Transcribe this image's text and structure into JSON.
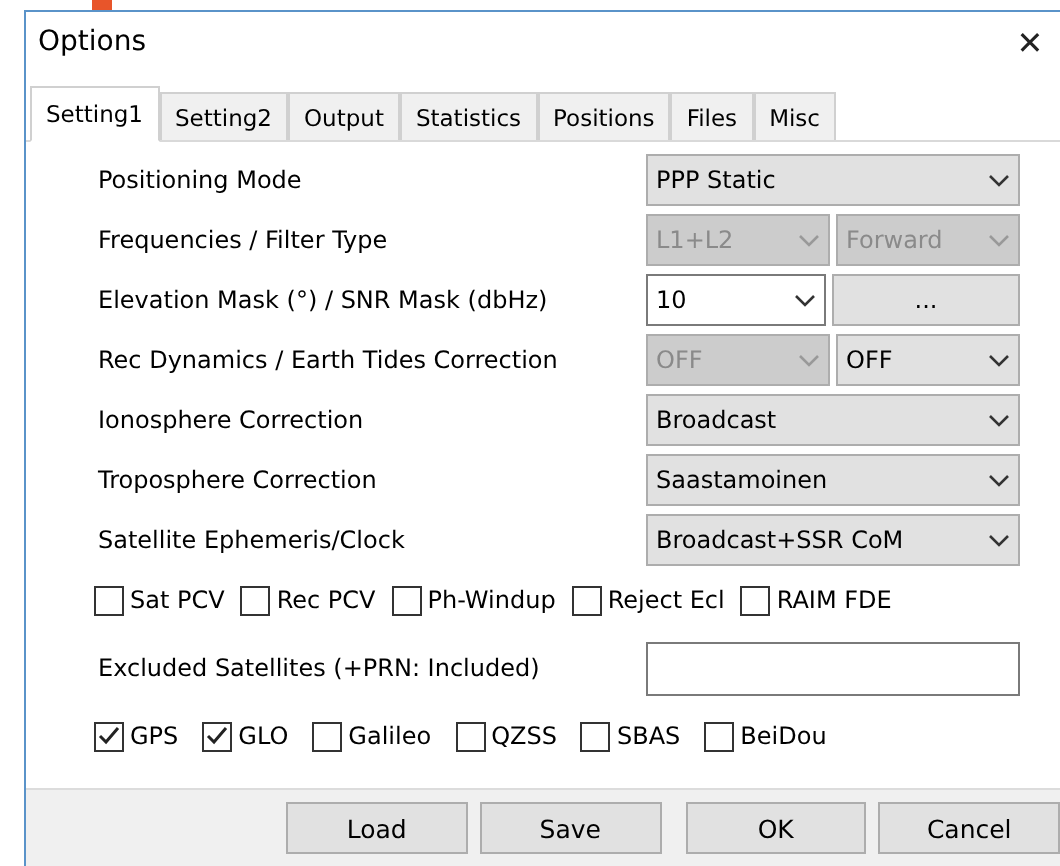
{
  "window": {
    "title": "Options",
    "close": "✕"
  },
  "tabs": [
    {
      "label": "Setting1",
      "selected": true
    },
    {
      "label": "Setting2",
      "selected": false
    },
    {
      "label": "Output",
      "selected": false
    },
    {
      "label": "Statistics",
      "selected": false
    },
    {
      "label": "Positions",
      "selected": false
    },
    {
      "label": "Files",
      "selected": false
    },
    {
      "label": "Misc",
      "selected": false
    }
  ],
  "rows": [
    {
      "label": "Positioning Mode",
      "controls": [
        {
          "kind": "combo",
          "value": "PPP Static",
          "disabled": false
        }
      ]
    },
    {
      "label": "Frequencies / Filter Type",
      "controls": [
        {
          "kind": "combo",
          "value": "L1+L2",
          "disabled": true
        },
        {
          "kind": "combo",
          "value": "Forward",
          "disabled": true
        }
      ]
    },
    {
      "label": "Elevation Mask (°) / SNR Mask (dbHz)",
      "controls": [
        {
          "kind": "edit-combo",
          "value": "10",
          "disabled": false
        },
        {
          "kind": "button",
          "value": "...",
          "disabled": false
        }
      ]
    },
    {
      "label": "Rec Dynamics / Earth Tides Correction",
      "controls": [
        {
          "kind": "combo",
          "value": "OFF",
          "disabled": true
        },
        {
          "kind": "combo",
          "value": "OFF",
          "disabled": false
        }
      ]
    },
    {
      "label": "Ionosphere Correction",
      "controls": [
        {
          "kind": "combo",
          "value": "Broadcast",
          "disabled": false
        }
      ]
    },
    {
      "label": "Troposphere Correction",
      "controls": [
        {
          "kind": "combo",
          "value": "Saastamoinen",
          "disabled": false
        }
      ]
    },
    {
      "label": "Satellite Ephemeris/Clock",
      "controls": [
        {
          "kind": "combo",
          "value": "Broadcast+SSR CoM",
          "disabled": false
        }
      ]
    }
  ],
  "options": [
    {
      "label": "Sat PCV",
      "checked": false
    },
    {
      "label": "Rec PCV",
      "checked": false
    },
    {
      "label": "Ph-Windup",
      "checked": false
    },
    {
      "label": "Reject Ecl",
      "checked": false
    },
    {
      "label": "RAIM FDE",
      "checked": false
    }
  ],
  "excluded_satellites": {
    "label": "Excluded Satellites (+PRN: Included)"
  },
  "systems": [
    {
      "label": "GPS",
      "checked": true
    },
    {
      "label": "GLO",
      "checked": true
    },
    {
      "label": "Galileo",
      "checked": false
    },
    {
      "label": "QZSS",
      "checked": false
    },
    {
      "label": "SBAS",
      "checked": false
    },
    {
      "label": "BeiDou",
      "checked": false
    }
  ],
  "buttons": [
    "Load",
    "Save",
    "OK",
    "Cancel"
  ]
}
